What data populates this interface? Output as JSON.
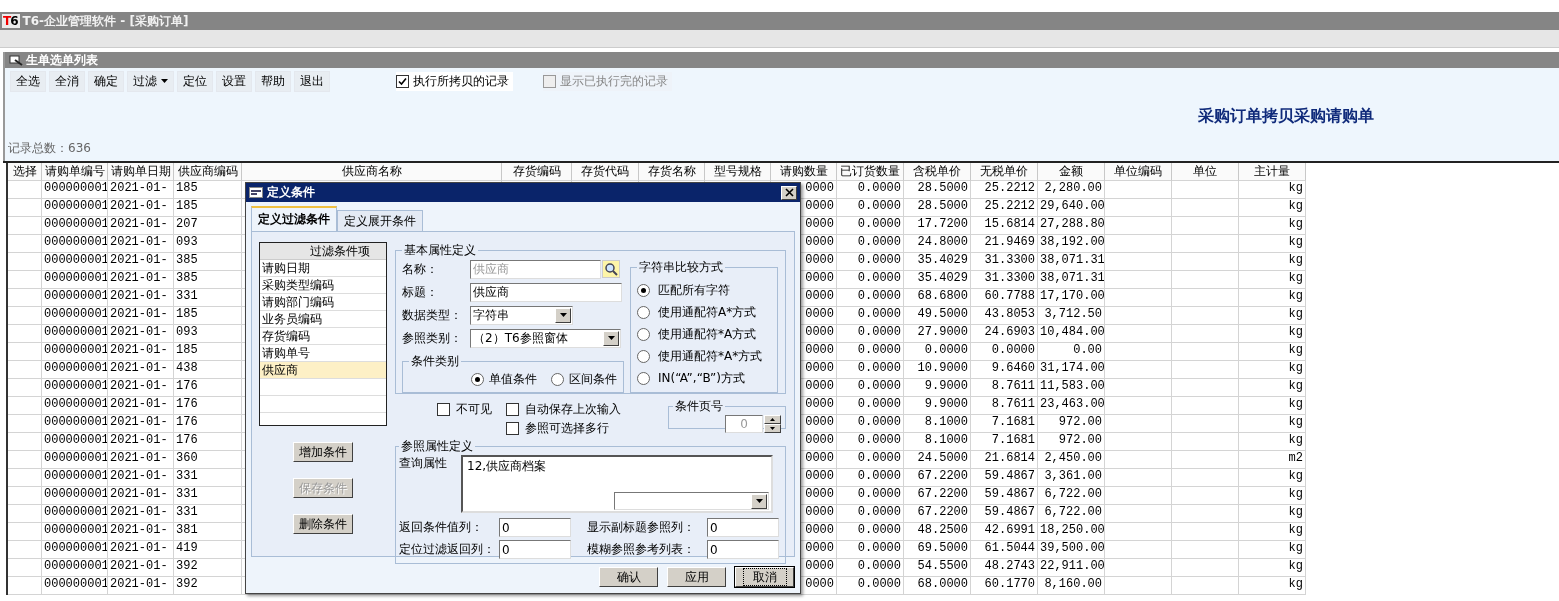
{
  "app": {
    "logo": "T6",
    "title": "T6-企业管理软件 - [采购订单]"
  },
  "panel": {
    "title": "生单选单列表",
    "toolbar": [
      {
        "label": "全选",
        "dropdown": false
      },
      {
        "label": "全消",
        "dropdown": false
      },
      {
        "label": "确定",
        "dropdown": false
      },
      {
        "label": "过滤",
        "dropdown": true
      },
      {
        "label": "定位",
        "dropdown": false
      },
      {
        "label": "设置",
        "dropdown": false
      },
      {
        "label": "帮助",
        "dropdown": false
      },
      {
        "label": "退出",
        "dropdown": false
      }
    ],
    "options": [
      {
        "label": "执行所拷贝的记录",
        "checked": true,
        "disabled": false
      },
      {
        "label": "显示已执行完的记录",
        "checked": false,
        "disabled": true
      }
    ],
    "heading": "采购订单拷贝采购请购单",
    "record_count": "记录总数：636"
  },
  "table": {
    "columns": [
      "选择",
      "请购单编号",
      "请购单日期",
      "供应商编码",
      "供应商名称",
      "存货编码",
      "存货代码",
      "存货名称",
      "型号规格",
      "请购数量",
      "已订货数量",
      "含税单价",
      "无税单价",
      "金额",
      "单位编码",
      "单位",
      "主计量"
    ],
    "rows": [
      {
        "number": "000000001",
        "date": "2021-01-",
        "supplier_code": "185",
        "requested_qty": "0000",
        "ordered_qty": "0.0000",
        "price_with_tax": "28.5000",
        "price_without_tax": "25.2212",
        "amount": "2,280.00",
        "main_unit": "kg"
      },
      {
        "number": "000000001",
        "date": "2021-01-",
        "supplier_code": "185",
        "requested_qty": "0000",
        "ordered_qty": "0.0000",
        "price_with_tax": "28.5000",
        "price_without_tax": "25.2212",
        "amount": "29,640.00",
        "main_unit": "kg"
      },
      {
        "number": "000000001",
        "date": "2021-01-",
        "supplier_code": "207",
        "requested_qty": "0000",
        "ordered_qty": "0.0000",
        "price_with_tax": "17.7200",
        "price_without_tax": "15.6814",
        "amount": "27,288.80",
        "main_unit": "kg"
      },
      {
        "number": "000000001",
        "date": "2021-01-",
        "supplier_code": "093",
        "requested_qty": "0000",
        "ordered_qty": "0.0000",
        "price_with_tax": "24.8000",
        "price_without_tax": "21.9469",
        "amount": "38,192.00",
        "main_unit": "kg"
      },
      {
        "number": "000000001",
        "date": "2021-01-",
        "supplier_code": "385",
        "requested_qty": "0000",
        "ordered_qty": "0.0000",
        "price_with_tax": "35.4029",
        "price_without_tax": "31.3300",
        "amount": "38,071.31",
        "main_unit": "kg"
      },
      {
        "number": "000000001",
        "date": "2021-01-",
        "supplier_code": "385",
        "requested_qty": "0000",
        "ordered_qty": "0.0000",
        "price_with_tax": "35.4029",
        "price_without_tax": "31.3300",
        "amount": "38,071.31",
        "main_unit": "kg"
      },
      {
        "number": "000000001",
        "date": "2021-01-",
        "supplier_code": "331",
        "requested_qty": "0000",
        "ordered_qty": "0.0000",
        "price_with_tax": "68.6800",
        "price_without_tax": "60.7788",
        "amount": "17,170.00",
        "main_unit": "kg"
      },
      {
        "number": "000000001",
        "date": "2021-01-",
        "supplier_code": "185",
        "requested_qty": "0000",
        "ordered_qty": "0.0000",
        "price_with_tax": "49.5000",
        "price_without_tax": "43.8053",
        "amount": "3,712.50",
        "main_unit": "kg"
      },
      {
        "number": "000000001",
        "date": "2021-01-",
        "supplier_code": "093",
        "requested_qty": "0000",
        "ordered_qty": "0.0000",
        "price_with_tax": "27.9000",
        "price_without_tax": "24.6903",
        "amount": "10,484.00",
        "main_unit": "kg"
      },
      {
        "number": "000000001",
        "date": "2021-01-",
        "supplier_code": "185",
        "requested_qty": "0000",
        "ordered_qty": "0.0000",
        "price_with_tax": "0.0000",
        "price_without_tax": "0.0000",
        "amount": "0.00",
        "main_unit": "kg"
      },
      {
        "number": "000000001",
        "date": "2021-01-",
        "supplier_code": "438",
        "requested_qty": "0000",
        "ordered_qty": "0.0000",
        "price_with_tax": "10.9000",
        "price_without_tax": "9.6460",
        "amount": "31,174.00",
        "main_unit": "kg"
      },
      {
        "number": "000000001",
        "date": "2021-01-",
        "supplier_code": "176",
        "requested_qty": "0000",
        "ordered_qty": "0.0000",
        "price_with_tax": "9.9000",
        "price_without_tax": "8.7611",
        "amount": "11,583.00",
        "main_unit": "kg"
      },
      {
        "number": "000000001",
        "date": "2021-01-",
        "supplier_code": "176",
        "requested_qty": "0000",
        "ordered_qty": "0.0000",
        "price_with_tax": "9.9000",
        "price_without_tax": "8.7611",
        "amount": "23,463.00",
        "main_unit": "kg"
      },
      {
        "number": "000000001",
        "date": "2021-01-",
        "supplier_code": "176",
        "requested_qty": "0000",
        "ordered_qty": "0.0000",
        "price_with_tax": "8.1000",
        "price_without_tax": "7.1681",
        "amount": "972.00",
        "main_unit": "kg"
      },
      {
        "number": "000000001",
        "date": "2021-01-",
        "supplier_code": "176",
        "requested_qty": "0000",
        "ordered_qty": "0.0000",
        "price_with_tax": "8.1000",
        "price_without_tax": "7.1681",
        "amount": "972.00",
        "main_unit": "kg"
      },
      {
        "number": "000000001",
        "date": "2021-01-",
        "supplier_code": "360",
        "requested_qty": "0000",
        "ordered_qty": "0.0000",
        "price_with_tax": "24.5000",
        "price_without_tax": "21.6814",
        "amount": "2,450.00",
        "main_unit": "m2"
      },
      {
        "number": "000000001",
        "date": "2021-01-",
        "supplier_code": "331",
        "requested_qty": "0000",
        "ordered_qty": "0.0000",
        "price_with_tax": "67.2200",
        "price_without_tax": "59.4867",
        "amount": "3,361.00",
        "main_unit": "kg"
      },
      {
        "number": "000000001",
        "date": "2021-01-",
        "supplier_code": "331",
        "requested_qty": "0000",
        "ordered_qty": "0.0000",
        "price_with_tax": "67.2200",
        "price_without_tax": "59.4867",
        "amount": "6,722.00",
        "main_unit": "kg"
      },
      {
        "number": "000000001",
        "date": "2021-01-",
        "supplier_code": "331",
        "requested_qty": "0000",
        "ordered_qty": "0.0000",
        "price_with_tax": "67.2200",
        "price_without_tax": "59.4867",
        "amount": "6,722.00",
        "main_unit": "kg"
      },
      {
        "number": "000000001",
        "date": "2021-01-",
        "supplier_code": "381",
        "requested_qty": "0000",
        "ordered_qty": "0.0000",
        "price_with_tax": "48.2500",
        "price_without_tax": "42.6991",
        "amount": "18,250.00",
        "main_unit": "kg"
      },
      {
        "number": "000000001",
        "date": "2021-01-",
        "supplier_code": "419",
        "requested_qty": "0000",
        "ordered_qty": "0.0000",
        "price_with_tax": "69.5000",
        "price_without_tax": "61.5044",
        "amount": "39,500.00",
        "main_unit": "kg"
      },
      {
        "number": "000000001",
        "date": "2021-01-",
        "supplier_code": "392",
        "requested_qty": "0000",
        "ordered_qty": "0.0000",
        "price_with_tax": "54.5500",
        "price_without_tax": "48.2743",
        "amount": "22,911.00",
        "main_unit": "kg"
      },
      {
        "number": "000000001",
        "date": "2021-01-",
        "supplier_code": "392",
        "requested_qty": "0000",
        "ordered_qty": "0.0000",
        "price_with_tax": "68.0000",
        "price_without_tax": "60.1770",
        "amount": "8,160.00",
        "main_unit": "kg"
      }
    ]
  },
  "dialog": {
    "title": "定义条件",
    "tabs": [
      {
        "label": "定义过滤条件",
        "selected": true
      },
      {
        "label": "定义展开条件",
        "selected": false
      }
    ],
    "condition_list": {
      "header": "过滤条件项",
      "items": [
        {
          "label": "请购日期",
          "selected": false
        },
        {
          "label": "采购类型编码",
          "selected": false
        },
        {
          "label": "请购部门编码",
          "selected": false
        },
        {
          "label": "业务员编码",
          "selected": false
        },
        {
          "label": "存货编码",
          "selected": false
        },
        {
          "label": "请购单号",
          "selected": false
        },
        {
          "label": "供应商",
          "selected": true
        }
      ]
    },
    "condition_buttons": [
      {
        "label": "增加条件",
        "disabled": false
      },
      {
        "label": "保存条件",
        "disabled": true
      },
      {
        "label": "删除条件",
        "disabled": false
      }
    ],
    "basic_group": {
      "title": "基本属性定义",
      "fields": [
        {
          "label": "名称：",
          "value": "供应商",
          "kind": "lookup",
          "disabled": true
        },
        {
          "label": "标题：",
          "value": "供应商",
          "kind": "text",
          "disabled": false
        },
        {
          "label": "数据类型：",
          "value": "字符串",
          "kind": "select",
          "disabled": false
        },
        {
          "label": "参照类别：",
          "value": "（2）T6参照窗体",
          "kind": "select",
          "disabled": false
        }
      ],
      "condition_type": {
        "title": "条件类别",
        "options": [
          {
            "label": "单值条件",
            "selected": true
          },
          {
            "label": "区间条件",
            "selected": false
          }
        ]
      }
    },
    "compare_group": {
      "title": "字符串比较方式",
      "options": [
        {
          "label": "匹配所有字符",
          "selected": true
        },
        {
          "label": "使用通配符A*方式",
          "selected": false
        },
        {
          "label": "使用通配符*A方式",
          "selected": false
        },
        {
          "label": "使用通配符*A*方式",
          "selected": false
        },
        {
          "label": "IN(“A”,“B”)方式",
          "selected": false
        }
      ]
    },
    "checkboxes": [
      {
        "label": "不可见",
        "checked": false
      },
      {
        "label": "自动保存上次输入",
        "checked": false
      },
      {
        "label": "参照可选择多行",
        "checked": false
      }
    ],
    "page_group": {
      "title": "条件页号",
      "value": "0"
    },
    "ref_group": {
      "title": "参照属性定义",
      "query_label": "查询属性",
      "query_value": "12,供应商档案",
      "fields": [
        {
          "label": "返回条件值列：",
          "value": "0"
        },
        {
          "label": "显示副标题参照列：",
          "value": "0"
        },
        {
          "label": "定位过滤返回列：",
          "value": "0"
        },
        {
          "label": "模糊参照参考列表：",
          "value": "0"
        }
      ]
    },
    "footer_buttons": [
      {
        "label": "确认",
        "default": false
      },
      {
        "label": "应用",
        "default": false
      },
      {
        "label": "取消",
        "default": true
      }
    ]
  }
}
